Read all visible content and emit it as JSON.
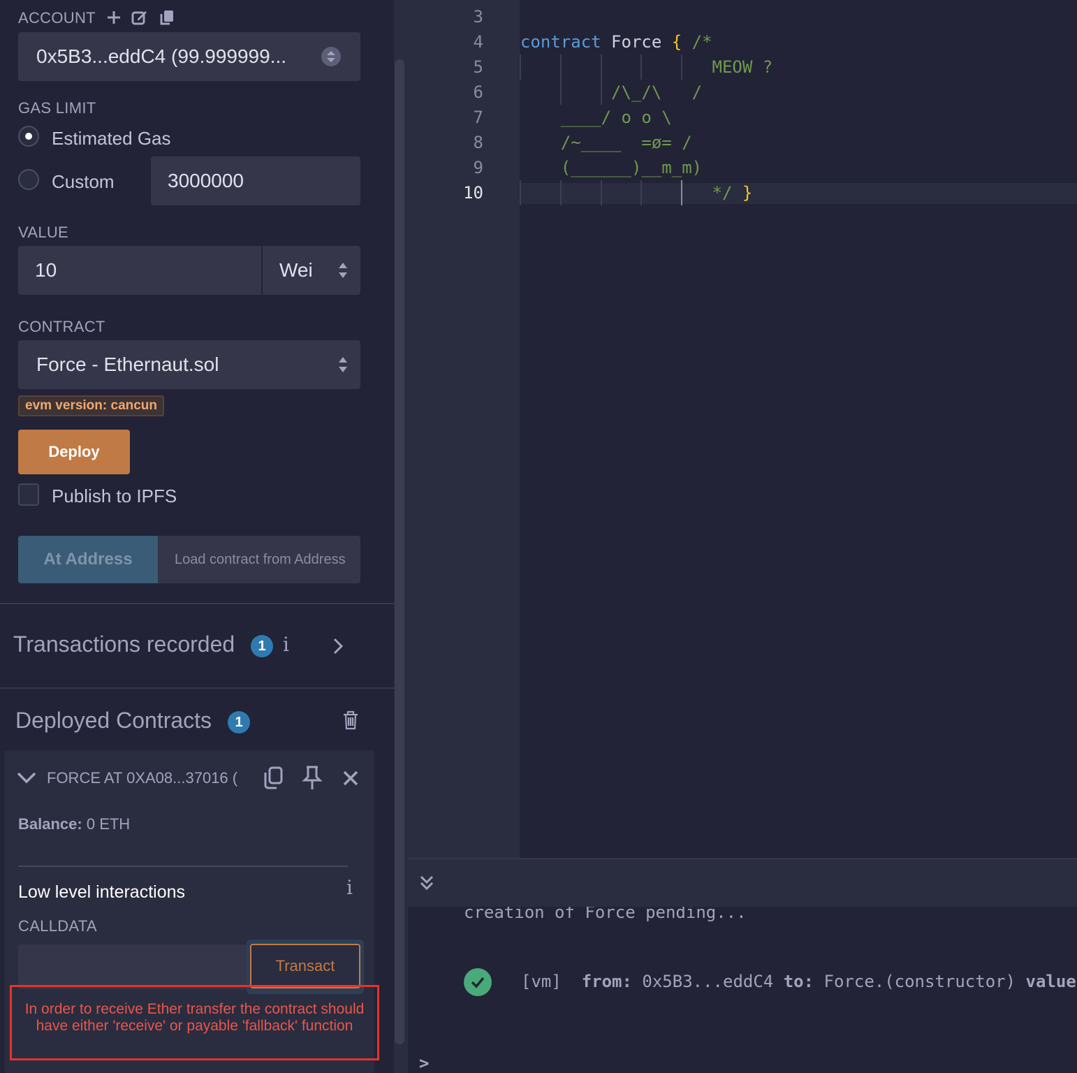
{
  "left_panel": {
    "account": {
      "label": "ACCOUNT",
      "value": "0x5B3...eddC4 (99.999999..."
    },
    "gas_limit": {
      "label": "GAS LIMIT",
      "estimated_label": "Estimated Gas",
      "custom_label": "Custom",
      "custom_value": "3000000",
      "selected": "Estimated Gas"
    },
    "value": {
      "label": "VALUE",
      "amount": "10",
      "unit": "Wei"
    },
    "contract": {
      "label": "CONTRACT",
      "selected": "Force - Ethernaut.sol"
    },
    "evm_badge": "evm version: cancun",
    "deploy_label": "Deploy",
    "publish_ipfs_label": "Publish to IPFS",
    "publish_ipfs_checked": false,
    "at_address_label": "At Address",
    "at_address_placeholder": "Load contract from Address",
    "transactions": {
      "title": "Transactions recorded",
      "count": "1",
      "info": "i"
    },
    "deployed": {
      "title": "Deployed Contracts",
      "count": "1"
    },
    "instance": {
      "title": "FORCE AT 0XA08...37016 (",
      "balance_label": "Balance:",
      "balance_value": "0 ETH",
      "low_level_title": "Low level interactions",
      "info": "i",
      "calldata_label": "CALLDATA",
      "calldata_value": "",
      "transact_label": "Transact",
      "error": "In order to receive Ether transfer the contract should have either 'receive' or payable 'fallback' function"
    }
  },
  "editor": {
    "active_line": "10",
    "lines": [
      {
        "n": "3",
        "text": ""
      },
      {
        "n": "4",
        "text": ""
      },
      {
        "n": "5",
        "text": "                   MEOW ?"
      },
      {
        "n": "6",
        "text": "         /\\_/\\   /"
      },
      {
        "n": "7",
        "text": "    ____/ o o \\"
      },
      {
        "n": "8",
        "text": "    /~____  =ø= /"
      },
      {
        "n": "9",
        "text": "    (______)__m_m)"
      },
      {
        "n": "10",
        "text": "                   */"
      }
    ],
    "line4": {
      "keyword": "contract",
      "name": "Force",
      "brace": "{",
      "comment": "/*"
    },
    "line10_brace": "}",
    "colors": {
      "keyword": "#5b9bd5",
      "comment": "#6f9a4d",
      "brace": "#f5c623",
      "text": "#d0d0e0"
    }
  },
  "terminal": {
    "pending": "creation of Force pending...",
    "log": {
      "tag": "[vm]",
      "from_label": "from:",
      "from": "0x5B3...eddC4",
      "to_label": "to:",
      "to": "Force.(constructor)",
      "value_label": "value:"
    },
    "prompt": ">"
  }
}
